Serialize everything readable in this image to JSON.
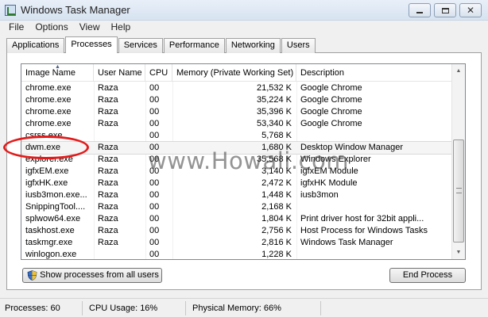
{
  "window": {
    "title": "Windows Task Manager"
  },
  "menu": [
    "File",
    "Options",
    "View",
    "Help"
  ],
  "tabs": [
    "Applications",
    "Processes",
    "Services",
    "Performance",
    "Networking",
    "Users"
  ],
  "active_tab": "Processes",
  "columns": [
    "Image Name",
    "User Name",
    "CPU",
    "Memory (Private Working Set)",
    "Description"
  ],
  "processes": [
    {
      "name": "chrome.exe",
      "user": "Raza",
      "cpu": "00",
      "mem": "21,532 K",
      "desc": "Google Chrome"
    },
    {
      "name": "chrome.exe",
      "user": "Raza",
      "cpu": "00",
      "mem": "35,224 K",
      "desc": "Google Chrome"
    },
    {
      "name": "chrome.exe",
      "user": "Raza",
      "cpu": "00",
      "mem": "35,396 K",
      "desc": "Google Chrome"
    },
    {
      "name": "chrome.exe",
      "user": "Raza",
      "cpu": "00",
      "mem": "53,340 K",
      "desc": "Google Chrome"
    },
    {
      "name": "csrss.exe",
      "user": "",
      "cpu": "00",
      "mem": "5,768 K",
      "desc": ""
    },
    {
      "name": "dwm.exe",
      "user": "Raza",
      "cpu": "00",
      "mem": "1,680 K",
      "desc": "Desktop Window Manager"
    },
    {
      "name": "explorer.exe",
      "user": "Raza",
      "cpu": "00",
      "mem": "35,568 K",
      "desc": "Windows Explorer"
    },
    {
      "name": "igfxEM.exe",
      "user": "Raza",
      "cpu": "00",
      "mem": "3,140 K",
      "desc": "igfxEM Module"
    },
    {
      "name": "igfxHK.exe",
      "user": "Raza",
      "cpu": "00",
      "mem": "2,472 K",
      "desc": "igfxHK Module"
    },
    {
      "name": "iusb3mon.exe...",
      "user": "Raza",
      "cpu": "00",
      "mem": "1,448 K",
      "desc": "iusb3mon"
    },
    {
      "name": "SnippingTool....",
      "user": "Raza",
      "cpu": "00",
      "mem": "2,168 K",
      "desc": ""
    },
    {
      "name": "splwow64.exe",
      "user": "Raza",
      "cpu": "00",
      "mem": "1,804 K",
      "desc": "Print driver host for 32bit appli..."
    },
    {
      "name": "taskhost.exe",
      "user": "Raza",
      "cpu": "00",
      "mem": "2,756 K",
      "desc": "Host Process for Windows Tasks"
    },
    {
      "name": "taskmgr.exe",
      "user": "Raza",
      "cpu": "00",
      "mem": "2,816 K",
      "desc": "Windows Task Manager"
    },
    {
      "name": "winlogon.exe",
      "user": "",
      "cpu": "00",
      "mem": "1,228 K",
      "desc": ""
    }
  ],
  "selected_process": "dwm.exe",
  "buttons": {
    "show_all": "Show processes from all users",
    "end_process": "End Process"
  },
  "status": {
    "processes": "Processes: 60",
    "cpu": "CPU Usage: 16%",
    "memory": "Physical Memory: 66%"
  },
  "watermark": "www.Howali.com",
  "icons": {
    "app": "task-manager-icon",
    "shield": "uac-shield-icon"
  }
}
